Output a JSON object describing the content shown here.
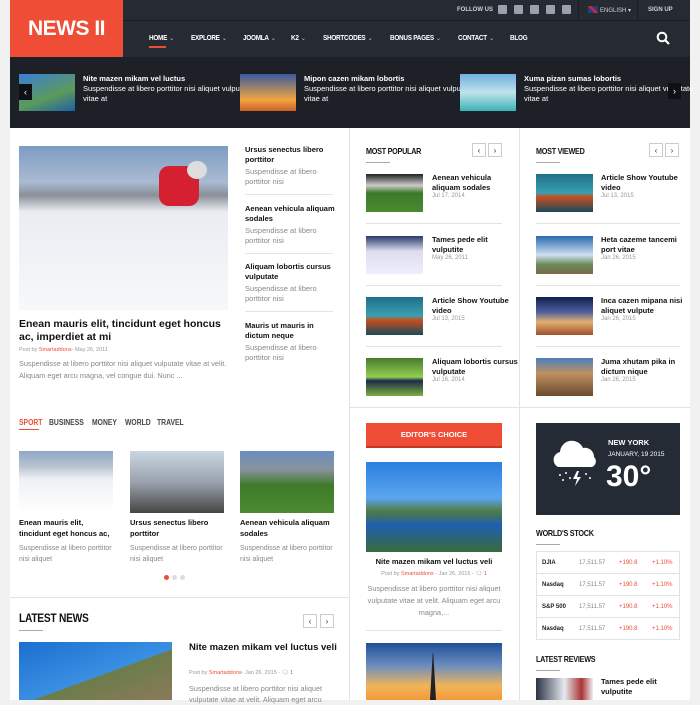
{
  "brand": {
    "logo": "NEWS II",
    "accent": "#ef4d35",
    "header_bg": "#262b33"
  },
  "topbar": {
    "follow_label": "FOLLOW US",
    "social_icons": [
      "facebook-icon",
      "vine-icon",
      "google-plus-icon",
      "pinterest-icon",
      "rss-icon"
    ],
    "language": "ENGLISH",
    "signup": "SIGN UP"
  },
  "nav": {
    "items": [
      {
        "label": "HOME",
        "dropdown": true,
        "active": true
      },
      {
        "label": "EXPLORE",
        "dropdown": true
      },
      {
        "label": "JOOMLA",
        "dropdown": true
      },
      {
        "label": "K2",
        "dropdown": true
      },
      {
        "label": "SHORTCODES",
        "dropdown": true
      },
      {
        "label": "BONUS PAGES",
        "dropdown": true
      },
      {
        "label": "CONTACT",
        "dropdown": true
      },
      {
        "label": "BLOG",
        "dropdown": false
      }
    ]
  },
  "ticker": [
    {
      "title": "Nite mazen mikam vel luctus",
      "excerpt": "Suspendisse at libero porttitor nisi aliquet vulputate vitae at"
    },
    {
      "title": "Mipon cazen mikam lobortis",
      "excerpt": "Suspendisse at libero porttitor nisi aliquet vulputate vitae at"
    },
    {
      "title": "Xuma pizan sumas lobortis",
      "excerpt": "Suspendisse at libero porttitor nisi aliquet vulputate vitae at"
    }
  ],
  "featured": {
    "title": "Enean mauris elit, tincidunt eget honcus ac, imperdiet at mi",
    "post_by": "Post by",
    "author": "Smartaddons",
    "date": "- May 26, 2011",
    "excerpt": "Suspendisse at libero porttitor nisi aliquet vulputate vitae at velit. Aliquam eget arcu magna, vel congue dui. Nunc ..."
  },
  "side_list": [
    {
      "title": "Ursus senectus libero porttitor",
      "excerpt": "Suspendisse at libero porttitor nisi"
    },
    {
      "title": "Aenean vehicula aliquam sodales",
      "excerpt": "Suspendisse at libero porttitor nisi"
    },
    {
      "title": "Aliquam lobortis cursus vulputate",
      "excerpt": "Suspendisse at libero porttitor nisi"
    },
    {
      "title": "Mauris ut mauris in dictum neque",
      "excerpt": "Suspendisse at libero porttitor nisi"
    }
  ],
  "category_tabs": [
    "SPORT",
    "BUSINESS",
    "MONEY",
    "WORLD",
    "TRAVEL"
  ],
  "category_cards": [
    {
      "title": "Enean mauris elit, tincidunt eget honcus ac,",
      "excerpt": "Suspendisse at libero porttitor nisi aliquet"
    },
    {
      "title": "Ursus senectus libero porttitor",
      "excerpt": "Suspendisse at libero porttitor nisi aliquet"
    },
    {
      "title": "Aenean vehicula aliquam sodales",
      "excerpt": "Suspendisse at libero porttitor nisi aliquet"
    }
  ],
  "latest_news": {
    "heading": "LATEST NEWS",
    "title": "Nite mazen mikam vel luctus veli",
    "post_by": "Post by",
    "author": "Smartaddons",
    "date": "- Jan 26, 2015 -",
    "comments": "1",
    "excerpt": "Suspendisse at libero porttitor nisi aliquet vulputate vitae at velit. Aliquam eget arcu"
  },
  "most_popular": {
    "heading": "MOST POPULAR",
    "items": [
      {
        "title": "Aenean vehicula aliquam sodales",
        "date": "Jul 17, 2014"
      },
      {
        "title": "Tames pede elit vulputite",
        "date": "May 26, 2011"
      },
      {
        "title": "Article Show Youtube video",
        "date": "Jul 13, 2015"
      },
      {
        "title": "Aliquam lobortis cursus vulputate",
        "date": "Jul 16, 2014"
      }
    ]
  },
  "most_viewed": {
    "heading": "MOST VIEWED",
    "items": [
      {
        "title": "Article Show Youtube video",
        "date": "Jul 13, 2015"
      },
      {
        "title": "Heta cazeme tancemi port vitae",
        "date": "Jan 26, 2015"
      },
      {
        "title": "Inca cazen mipana nisi aliquet vulpute",
        "date": "Jan 26, 2015"
      },
      {
        "title": "Juma xhutam pika in dictum nique",
        "date": "Jan 26, 2015"
      }
    ]
  },
  "editors_choice": {
    "heading": "EDITOR'S CHOICE",
    "title": "Nite mazen mikam vel luctus veli",
    "post_by": "Post by",
    "author": "Smartaddons",
    "date": "- Jan 26, 2015 -",
    "comments": "1",
    "excerpt": "Suspendisse at libero porttitor nisi aliquet vulputate vitae at velit. Aliquam eget arcu magna,..."
  },
  "weather": {
    "city": "NEW YORK",
    "date": "JANUARY, 19 2015",
    "temp": "30°",
    "icon": "thunderstorm-cloud-icon"
  },
  "stock": {
    "heading": "WORLD'S STOCK",
    "rows": [
      {
        "name": "DJIA",
        "value": "17,511.57",
        "change": "+190.8",
        "pct": "+1.10%"
      },
      {
        "name": "Nasdaq",
        "value": "17,511.57",
        "change": "+190.8",
        "pct": "+1.10%"
      },
      {
        "name": "S&P 500",
        "value": "17,511.57",
        "change": "+190.8",
        "pct": "+1.10%"
      },
      {
        "name": "Nasdaq",
        "value": "17,511.57",
        "change": "+190.8",
        "pct": "+1.10%"
      }
    ]
  },
  "latest_reviews": {
    "heading": "LATEST REVIEWS",
    "items": [
      {
        "title": "Tames pede elit vulputite"
      }
    ]
  }
}
